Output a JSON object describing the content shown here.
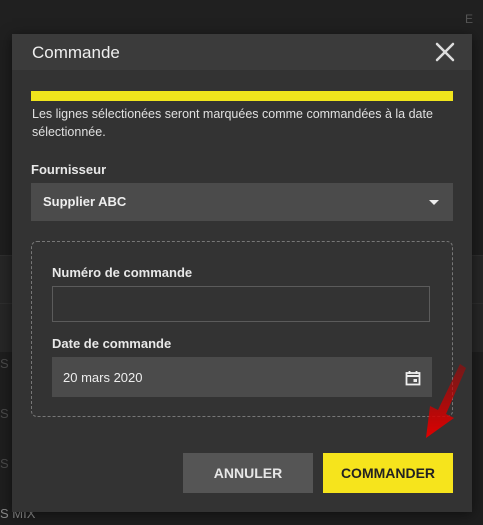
{
  "background": {
    "topbar_text": "E",
    "row_letters": [
      "S",
      "S",
      "S",
      "S"
    ],
    "bottom_text": "S MIX"
  },
  "dialog": {
    "title": "Commande",
    "info_text": "Les lignes sélectionées seront marquées comme commandées à la date sélectionnée.",
    "supplier": {
      "label": "Fournisseur",
      "value": "Supplier ABC"
    },
    "order_number": {
      "label": "Numéro de commande",
      "value": "",
      "placeholder": ""
    },
    "order_date": {
      "label": "Date de commande",
      "value": "20 mars 2020"
    },
    "buttons": {
      "cancel": "ANNULER",
      "order": "COMMANDER"
    }
  },
  "colors": {
    "accent": "#f6e41c",
    "modal_bg": "#333333",
    "annotation_arrow": "#cc0000"
  },
  "icons": {
    "close": "close-icon",
    "dropdown": "chevron-down-icon",
    "calendar": "calendar-icon",
    "annotation": "red-arrow-icon"
  }
}
